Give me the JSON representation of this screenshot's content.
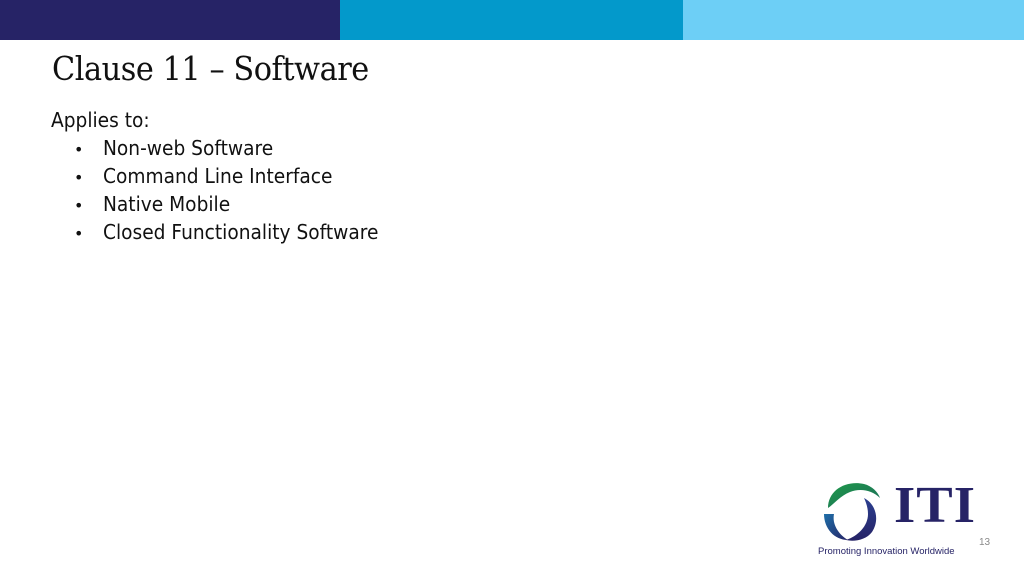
{
  "header": {
    "bar_colors": [
      "#262366",
      "#0399cb",
      "#6dcff6"
    ]
  },
  "slide": {
    "title": "Clause 11 – Software",
    "intro": "Applies to:",
    "bullet_glyph": "•",
    "bullets": [
      "Non-web Software",
      "Command Line Interface",
      "Native Mobile",
      "Closed Functionality Software"
    ]
  },
  "footer": {
    "logo_icon": "iti-swirl-logo",
    "logo_text": "ITI",
    "tagline": "Promoting Innovation Worldwide",
    "page_number": "13",
    "brand_color": "#262366",
    "accent_green": "#1f9a4a"
  }
}
